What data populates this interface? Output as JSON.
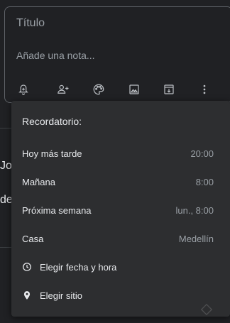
{
  "note": {
    "title_placeholder": "Título",
    "body_placeholder": "Añade una nota..."
  },
  "toolbar": {
    "icons": [
      "bell-plus-icon",
      "add-person-icon",
      "palette-icon",
      "image-icon",
      "archive-icon",
      "more-vert-icon"
    ]
  },
  "background": {
    "fragment_left_1": "Jo",
    "fragment_left_2": "de",
    "fragment_right": "li"
  },
  "reminder_menu": {
    "header": "Recordatorio:",
    "items": [
      {
        "label": "Hoy más tarde",
        "meta": "20:00"
      },
      {
        "label": "Mañana",
        "meta": "8:00"
      },
      {
        "label": "Próxima semana",
        "meta": "lun., 8:00"
      },
      {
        "label": "Casa",
        "meta": "Medellín"
      }
    ],
    "actions": [
      {
        "label": "Elegir fecha y hora",
        "icon": "clock-icon"
      },
      {
        "label": "Elegir sitio",
        "icon": "location-pin-icon"
      }
    ]
  },
  "colors": {
    "background": "#202124",
    "menu": "#2d2e30",
    "text": "#e8eaed",
    "muted": "#9aa0a6"
  }
}
